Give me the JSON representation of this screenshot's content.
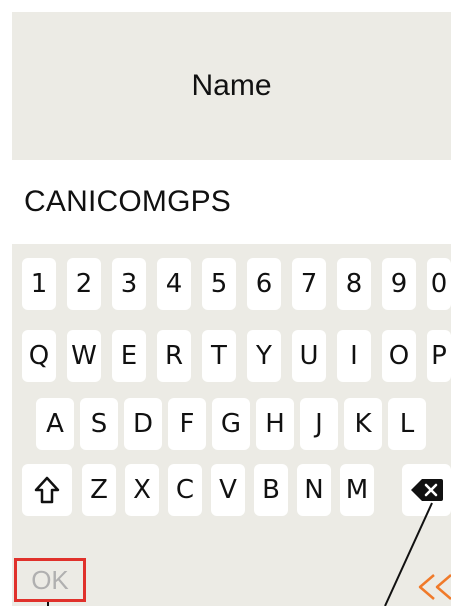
{
  "header": {
    "title": "Name"
  },
  "name_field": {
    "value": "CANICOMGPS"
  },
  "keyboard": {
    "row_numbers": [
      "1",
      "2",
      "3",
      "4",
      "5",
      "6",
      "7",
      "8",
      "9",
      "0"
    ],
    "row_top": [
      "Q",
      "W",
      "E",
      "R",
      "T",
      "Y",
      "U",
      "I",
      "O",
      "P"
    ],
    "row_middle": [
      "A",
      "S",
      "D",
      "F",
      "G",
      "H",
      "J",
      "K",
      "L"
    ],
    "row_bottom": [
      "Z",
      "X",
      "C",
      "V",
      "B",
      "N",
      "M"
    ],
    "shift_icon": "shift-arrow-icon",
    "backspace_icon": "backspace-icon"
  },
  "footer": {
    "ok_label": "OK",
    "back_icon": "double-chevron-left-icon"
  },
  "colors": {
    "background": "#ecebe5",
    "accent": "#e0312b",
    "back_arrow": "#f07a2a"
  }
}
